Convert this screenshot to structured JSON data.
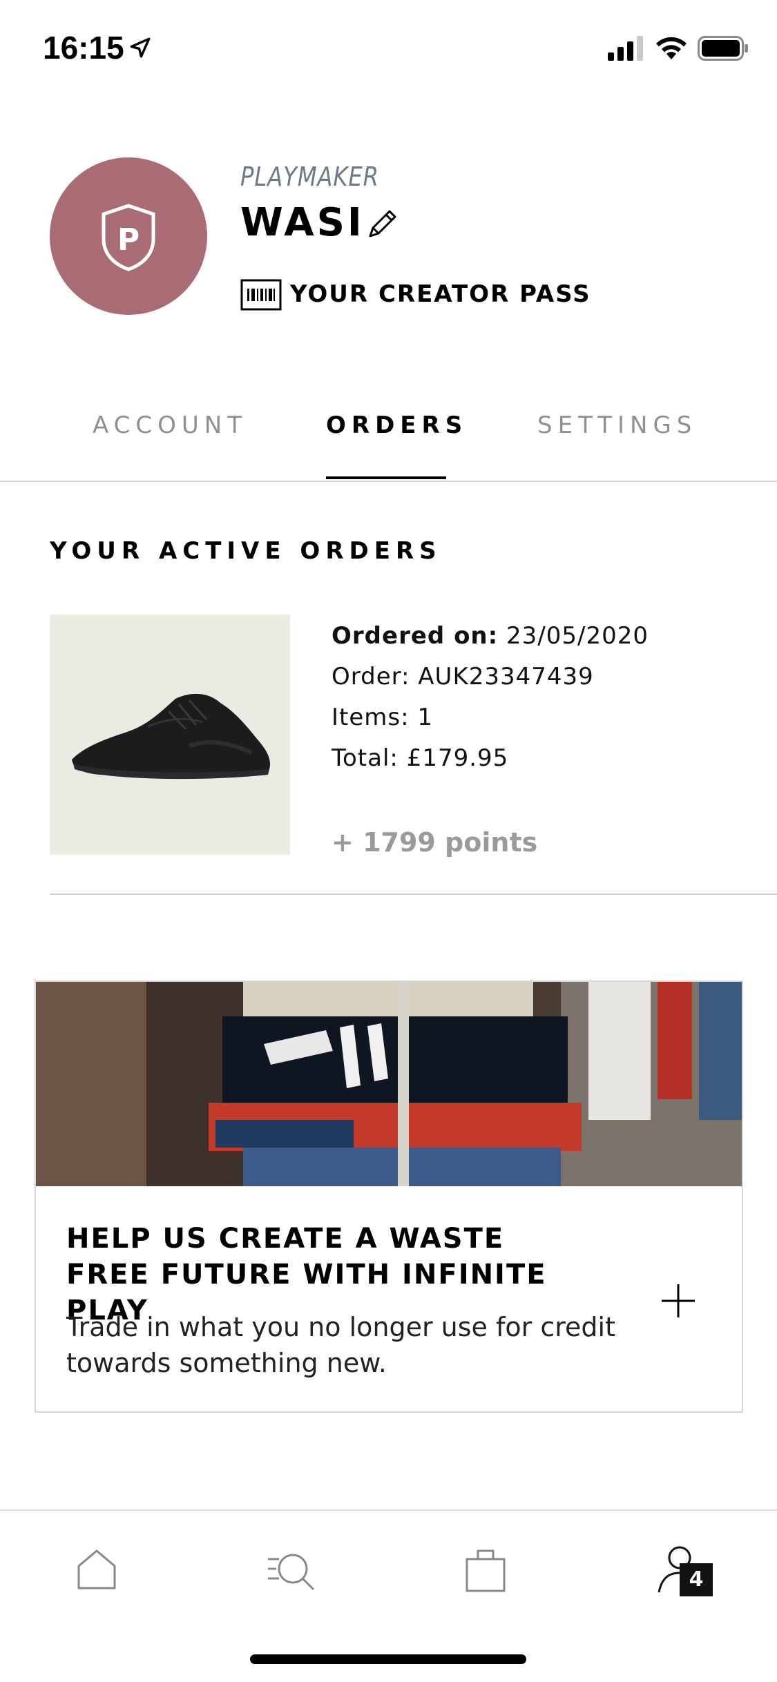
{
  "status_bar": {
    "time": "16:15"
  },
  "profile": {
    "tier": "PLAYMAKER",
    "username": "WASI",
    "avatar_letter": "P",
    "avatar_color": "#a96b74",
    "creator_pass_label": "YOUR CREATOR PASS"
  },
  "tabs": [
    {
      "label": "ACCOUNT",
      "active": false
    },
    {
      "label": "ORDERS",
      "active": true
    },
    {
      "label": "SETTINGS",
      "active": false
    }
  ],
  "orders_section": {
    "title": "YOUR ACTIVE ORDERS",
    "orders": [
      {
        "ordered_on_label": "Ordered on:",
        "ordered_on_value": "23/05/2020",
        "order_label": "Order:",
        "order_value": "AUK23347439",
        "items_label": "Items:",
        "items_value": "1",
        "total_label": "Total:",
        "total_value": "£179.95",
        "points": "+ 1799 points"
      }
    ]
  },
  "promo": {
    "title": "HELP US CREATE A WASTE FREE FUTURE WITH INFINITE PLAY",
    "text": "Trade in what you no longer use for credit towards something new.",
    "expand_icon": "plus-icon"
  },
  "bottom_nav": {
    "items": [
      {
        "icon": "home-icon"
      },
      {
        "icon": "search-icon"
      },
      {
        "icon": "bag-icon"
      },
      {
        "icon": "account-icon"
      }
    ],
    "account_badge": "4"
  }
}
